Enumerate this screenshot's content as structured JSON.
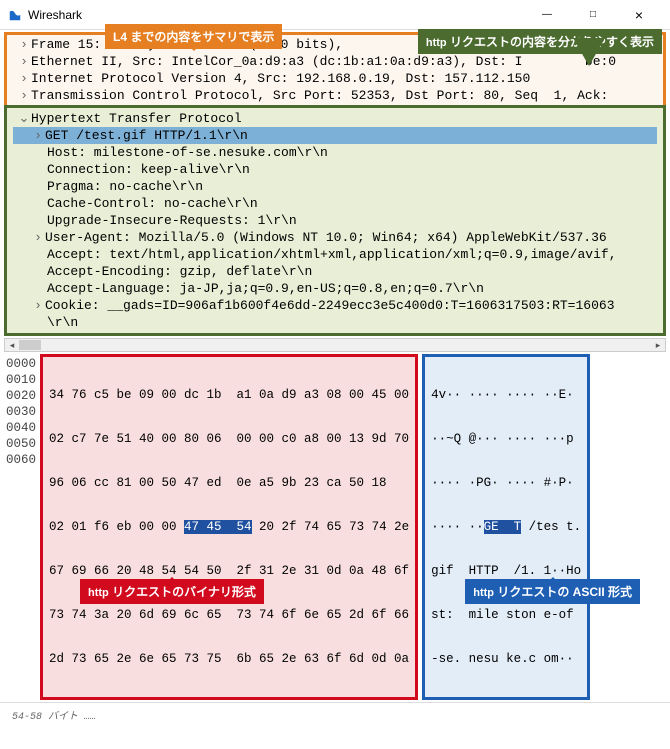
{
  "window": {
    "title": "Wireshark",
    "min": "—",
    "max": "□",
    "close": "×"
  },
  "annotations": {
    "summary_label": "L4 までの内容をサマリで表示",
    "http_label_prefix": "http",
    "http_label_rest": " リクエストの内容を分かりやすく表示",
    "binary_prefix": "http",
    "binary_rest": " リクエストのバイナリ形式",
    "ascii_prefix": "http",
    "ascii_rest": " リクエストの ASCII 形式"
  },
  "summary": {
    "lines": [
      "Frame 15: 725 bytes on wire (5800 bits),",
      "Ethernet II, Src: IntelCor_0a:d9:a3 (dc:1b:a1:0a:d9:a3), Dst: I        be:0",
      "Internet Protocol Version 4, Src: 192.168.0.19, Dst: 157.112.150",
      "Transmission Control Protocol, Src Port: 52353, Dst Port: 80, Seq  1, Ack:"
    ]
  },
  "http": {
    "title": "Hypertext Transfer Protocol",
    "get_line": "GET /test.gif HTTP/1.1\\r\\n",
    "headers": [
      "Host: milestone-of-se.nesuke.com\\r\\n",
      "Connection: keep-alive\\r\\n",
      "Pragma: no-cache\\r\\n",
      "Cache-Control: no-cache\\r\\n",
      "Upgrade-Insecure-Requests: 1\\r\\n",
      "User-Agent: Mozilla/5.0 (Windows NT 10.0; Win64; x64) AppleWebKit/537.36",
      "Accept: text/html,application/xhtml+xml,application/xml;q=0.9,image/avif,",
      "Accept-Encoding: gzip, deflate\\r\\n",
      "Accept-Language: ja-JP,ja;q=0.9,en-US;q=0.8,en;q=0.7\\r\\n",
      "Cookie: __gads=ID=906af1b600f4e6dd-2249ecc3e5c400d0:T=1606317503:RT=16063",
      "\\r\\n"
    ]
  },
  "hex": {
    "offsets": [
      "0000",
      "0010",
      "0020",
      "0030",
      "0040",
      "0050",
      "0060"
    ],
    "rows": [
      "34 76 c5 be 09 00 dc 1b  a1 0a d9 a3 08 00 45 00",
      "02 c7 7e 51 40 00 80 06  00 00 c0 a8 00 13 9d 70",
      "96 06 cc 81 00 50 47 ed  0e a5 9b 23 ca 50 18",
      "67 69 66 20 48 54 54 50  2f 31 2e 31 0d 0a 48 6f",
      "73 74 3a 20 6d 69 6c 65  73 74 6f 6e 65 2d 6f 66",
      "2d 73 65 2e 6e 65 73 75  6b 65 2e 63 6f 6d 0d 0a"
    ],
    "row3_pre": "02 01 f6 eb 00 00 ",
    "row3_sel": "47 45  54",
    "row3_post": " 20 2f 74 65 73 74 2e"
  },
  "ascii": {
    "rows": [
      "4v·· ···· ···· ··E·",
      "··~Q @··· ···· ···p",
      "···· ·PG· ···· #·P·",
      "gif  HTTP  /1. 1··Ho",
      "st:  mile ston e-of",
      "-se. nesu ke.c om··"
    ],
    "row3_pre": "···· ··",
    "row3_sel": "GE  T",
    "row3_post": " /tes t."
  },
  "status": "54-58 バイト ……"
}
